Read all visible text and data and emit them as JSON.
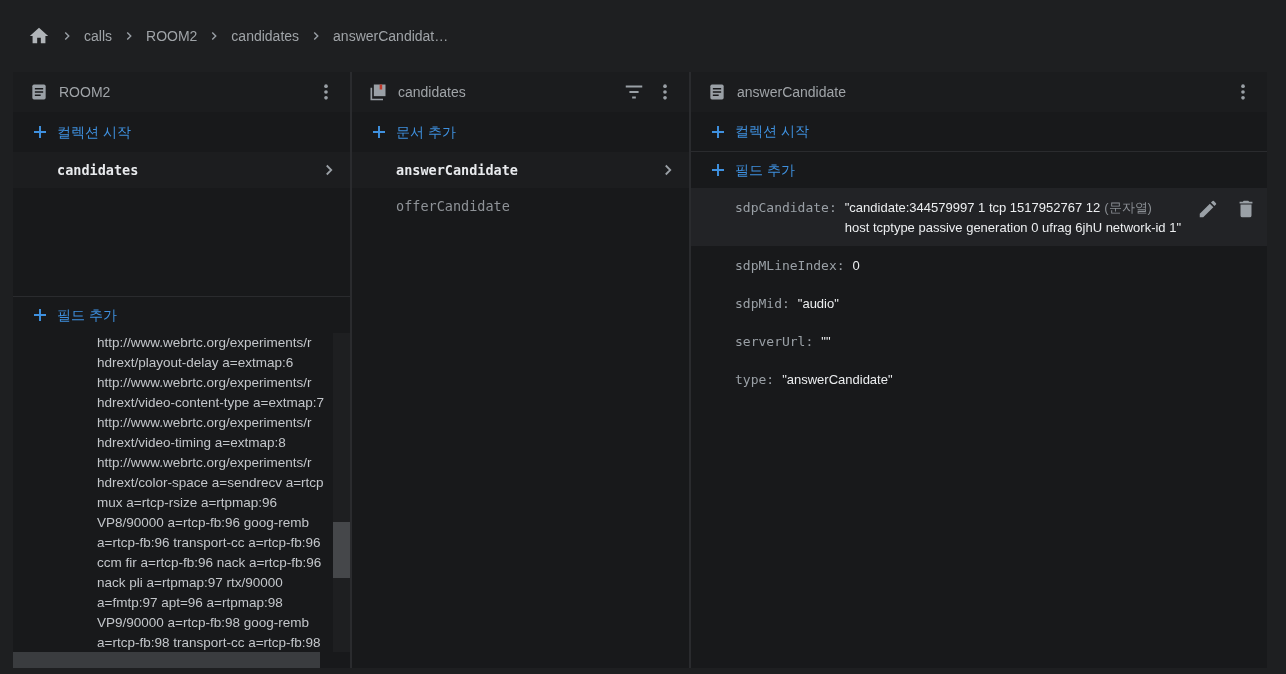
{
  "breadcrumb": [
    "calls",
    "ROOM2",
    "candidates",
    "answerCandidat…"
  ],
  "panels": [
    {
      "kind": "document",
      "title": "ROOM2",
      "tools": [
        {
          "kind": "more"
        }
      ],
      "add_label": "컬렉션 시작",
      "items": [
        {
          "label": "candidates",
          "selected": true
        }
      ],
      "field_add": "필드 추가",
      "value_lines": [
        "http://www.webrtc.org/experiments/r",
        "hdrext/playout-delay a=extmap:6",
        "http://www.webrtc.org/experiments/r",
        "hdrext/video-content-type a=extmap:7",
        "http://www.webrtc.org/experiments/r",
        "hdrext/video-timing a=extmap:8",
        "http://www.webrtc.org/experiments/r",
        "hdrext/color-space a=sendrecv a=rtcp",
        "mux a=rtcp-rsize a=rtpmap:96",
        "VP8/90000 a=rtcp-fb:96 goog-remb",
        "a=rtcp-fb:96 transport-cc a=rtcp-fb:96",
        "ccm fir a=rtcp-fb:96 nack a=rtcp-fb:96",
        "nack pli a=rtpmap:97 rtx/90000",
        "a=fmtp:97 apt=96 a=rtpmap:98",
        "VP9/90000 a=rtcp-fb:98 goog-remb",
        "a=rtcp-fb:98 transport-cc a=rtcp-fb:98"
      ]
    },
    {
      "kind": "collection",
      "title": "candidates",
      "tools": [
        {
          "kind": "filter"
        },
        {
          "kind": "more"
        }
      ],
      "add_label": "문서 추가",
      "items": [
        {
          "label": "answerCandidate",
          "selected": true
        },
        {
          "label": "offerCandidate",
          "selected": false
        }
      ]
    },
    {
      "kind": "document",
      "title": "answerCandidate",
      "tools": [
        {
          "kind": "more"
        }
      ],
      "add_label": "컬렉션 시작",
      "field_add": "필드 추가",
      "fields": [
        {
          "name": "sdpCandidate:",
          "value_lines": [
            "\"candidate:344579997 1 tcp 1517952767 12",
            "host tcptype passive generation 0 ufrag 6jhU network-id 1\""
          ],
          "type_label": "(문자열)",
          "highlighted": true
        },
        {
          "name": "sdpMLineIndex:",
          "value_lines": [
            "0"
          ],
          "highlighted": false
        },
        {
          "name": "sdpMid:",
          "value_lines": [
            "\"audio\""
          ],
          "highlighted": false
        },
        {
          "name": "serverUrl:",
          "value_lines": [
            "\"\""
          ],
          "highlighted": false
        },
        {
          "name": "type:",
          "value_lines": [
            "\"answerCandidate\""
          ],
          "highlighted": false
        }
      ]
    }
  ]
}
